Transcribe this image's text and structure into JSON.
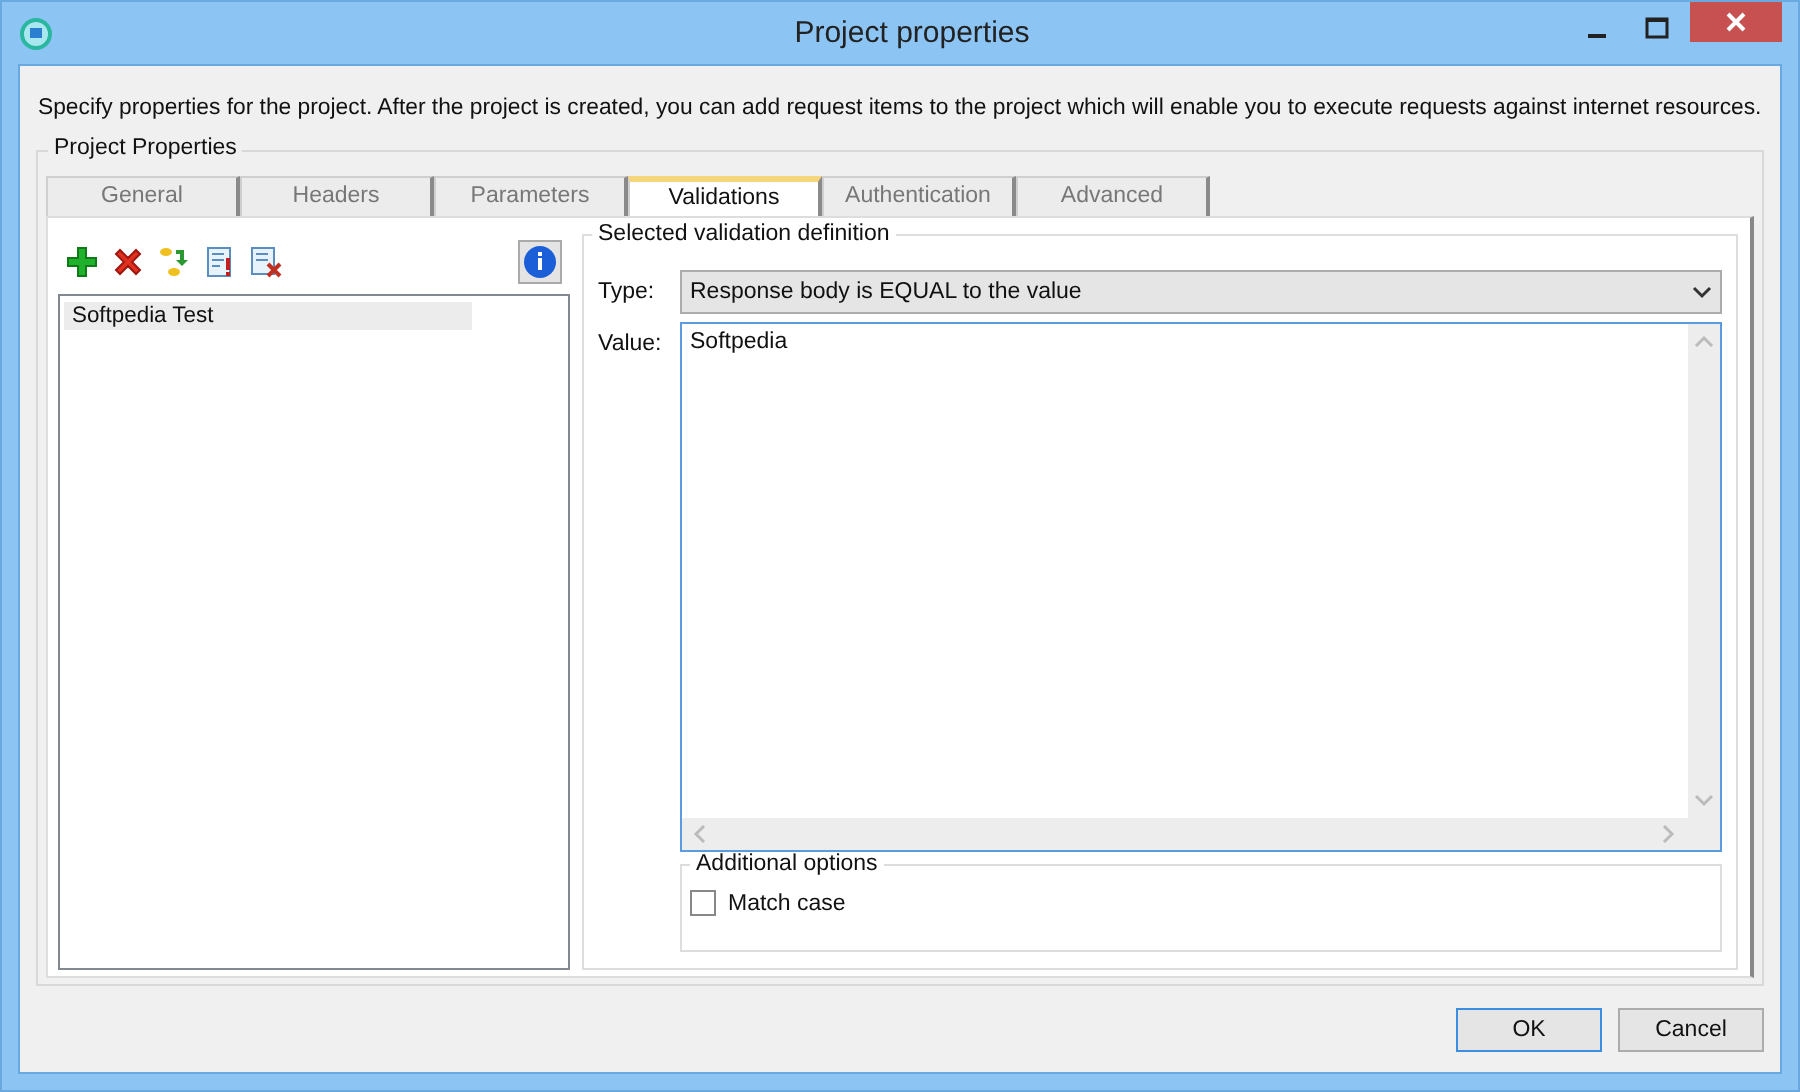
{
  "window": {
    "title": "Project properties"
  },
  "description": "Specify properties for the project. After the project is created, you can add request items to the project which will enable you to execute requests against internet resources.",
  "group_title": "Project Properties",
  "tabs": [
    {
      "label": "General",
      "selected": false
    },
    {
      "label": "Headers",
      "selected": false
    },
    {
      "label": "Parameters",
      "selected": false
    },
    {
      "label": "Validations",
      "selected": true
    },
    {
      "label": "Authentication",
      "selected": false
    },
    {
      "label": "Advanced",
      "selected": false
    }
  ],
  "validations": {
    "items": [
      {
        "label": "Softpedia Test",
        "selected": true
      }
    ],
    "definition": {
      "title": "Selected validation definition",
      "type_label": "Type:",
      "type_value": "Response body is EQUAL to the value",
      "value_label": "Value:",
      "value_text": "Softpedia",
      "options": {
        "title": "Additional options",
        "match_case": {
          "label": "Match case",
          "checked": false
        }
      }
    }
  },
  "buttons": [
    {
      "label": "OK",
      "default": true
    },
    {
      "label": "Cancel",
      "default": false
    }
  ]
}
